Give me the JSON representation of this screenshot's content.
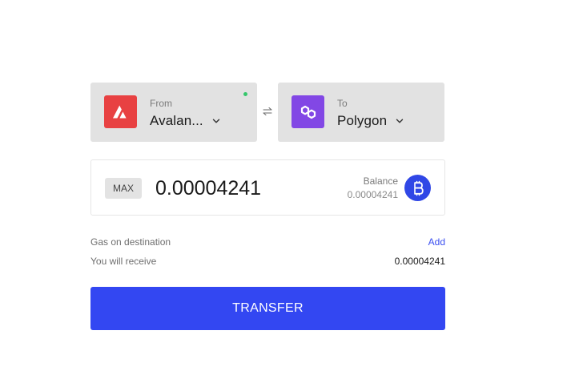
{
  "from": {
    "caption": "From",
    "chain": "Avalan...",
    "logo_icon": "avalanche-logo-icon",
    "logo_color": "#e84142",
    "status_color": "#35c76b"
  },
  "to": {
    "caption": "To",
    "chain": "Polygon",
    "logo_icon": "polygon-logo-icon",
    "logo_color": "#8247e5"
  },
  "swap_icon": "swap-arrows-icon",
  "amount": {
    "max_label": "MAX",
    "value": "0.00004241",
    "balance_label": "Balance",
    "balance_value": "0.00004241",
    "token_icon": "bitcoin-icon",
    "token_color": "#3047e6"
  },
  "gas": {
    "label": "Gas on destination",
    "action": "Add"
  },
  "receive": {
    "label": "You will receive",
    "value": "0.00004241"
  },
  "transfer": {
    "label": "TRANSFER",
    "color": "#3347f2"
  }
}
